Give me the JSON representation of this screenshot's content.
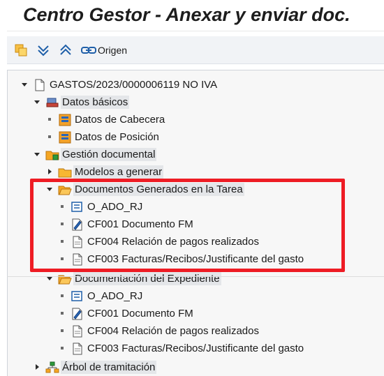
{
  "window": {
    "title": "Centro Gestor - Anexar y enviar doc."
  },
  "toolbar": {
    "origen_label": "Origen"
  },
  "tree": {
    "root": "GASTOS/2023/0000006119 NO IVA",
    "datos_basicos": "Datos básicos",
    "datos_cabecera": "Datos de Cabecera",
    "datos_posicion": "Datos de Posición",
    "gestion_documental": "Gestión documental",
    "modelos_generar": "Modelos a generar",
    "docs_generados": "Documentos Generados en la Tarea",
    "docs_generados_items": [
      {
        "label": "O_ADO_RJ"
      },
      {
        "label": "CF001 Documento FM"
      },
      {
        "label": "CF004 Relación de pagos realizados"
      },
      {
        "label": "CF003  Facturas/Recibos/Justificante del gasto"
      }
    ],
    "documentacion_expediente": "Documentación del Expediente",
    "expediente_items": [
      {
        "label": "O_ADO_RJ"
      },
      {
        "label": "CF001 Documento FM"
      },
      {
        "label": "CF004 Relación de pagos realizados"
      },
      {
        "label": "CF003  Facturas/Recibos/Justificante del gasto"
      }
    ],
    "arbol_tramitacion": "Árbol de tramitación"
  },
  "colors": {
    "highlight_border": "#ee1c24",
    "folder": "#f5a623",
    "tree_bg": "#f7f7f7"
  }
}
